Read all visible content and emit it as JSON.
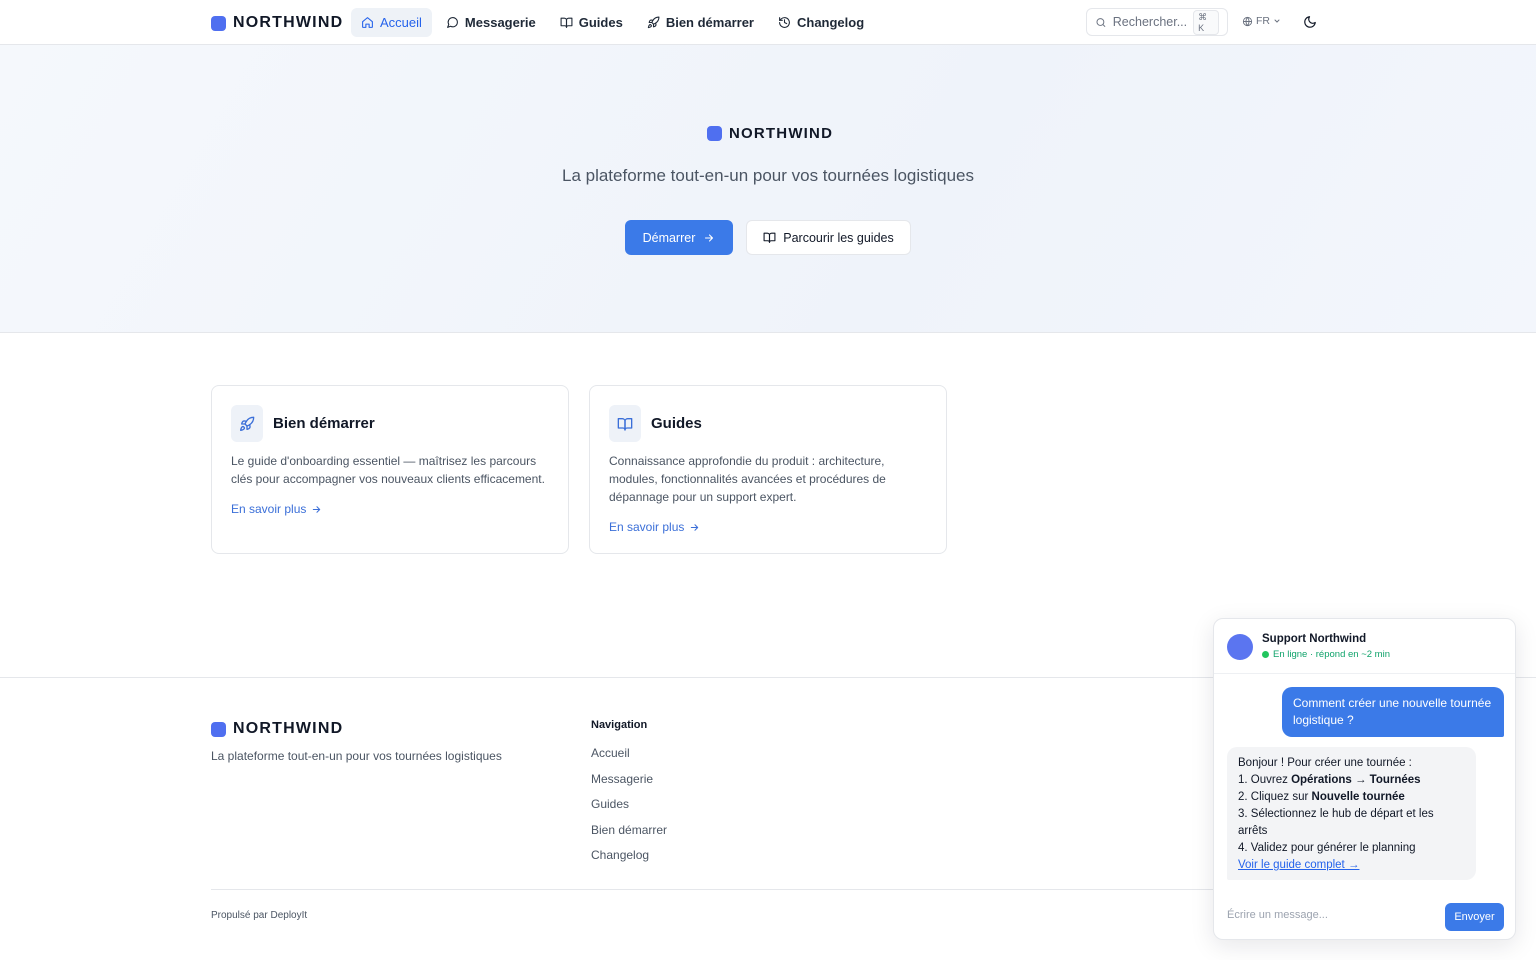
{
  "colors": {
    "accent": "#3b7ae8",
    "brand_square": "#4f6ff0",
    "online": "#22c55e"
  },
  "header": {
    "brand": "NORTHWIND",
    "nav": [
      {
        "label": "Accueil",
        "icon": "home-icon",
        "active": true
      },
      {
        "label": "Messagerie",
        "icon": "chat-bubble-icon"
      },
      {
        "label": "Guides",
        "icon": "book-icon"
      },
      {
        "label": "Bien démarrer",
        "icon": "rocket-icon"
      },
      {
        "label": "Changelog",
        "icon": "history-icon"
      }
    ],
    "search": {
      "placeholder": "Rechercher...",
      "shortcut": "⌘ K"
    },
    "language": "FR",
    "theme_icon": "moon-icon"
  },
  "hero": {
    "brand": "NORTHWIND",
    "tagline": "La plateforme tout-en-un pour vos tournées logistiques",
    "primary_button": "Démarrer",
    "secondary_button": "Parcourir les guides"
  },
  "cards": [
    {
      "title": "Bien démarrer",
      "icon": "rocket-icon",
      "description": "Le guide d'onboarding essentiel — maîtrisez les parcours clés pour accompagner vos nouveaux clients efficacement.",
      "link": "En savoir plus"
    },
    {
      "title": "Guides",
      "icon": "book-icon",
      "description": "Connaissance approfondie du produit : architecture, modules, fonctionnalités avancées et procédures de dépannage pour un support expert.",
      "link": "En savoir plus"
    }
  ],
  "footer": {
    "brand": "NORTHWIND",
    "tagline": "La plateforme tout-en-un pour vos tournées logistiques",
    "nav_heading": "Navigation",
    "nav_links": [
      "Accueil",
      "Messagerie",
      "Guides",
      "Bien démarrer",
      "Changelog"
    ],
    "powered_by": "Propulsé par DeployIt"
  },
  "chat": {
    "agent_name": "Support Northwind",
    "status": "En ligne · répond en ~2 min",
    "user_message": "Comment créer une nouvelle tournée logistique ?",
    "bot_message": {
      "greeting": "Bonjour ! Pour créer une tournée :",
      "step1_prefix": "1. Ouvrez ",
      "step1_bold": "Opérations → Tournées",
      "step2_prefix": "2. Cliquez sur ",
      "step2_bold": "Nouvelle tournée",
      "step3_line1": "3. Sélectionnez le hub de départ et les",
      "step3_line2": "arrêts",
      "step4": "4. Validez pour générer le planning",
      "link": "Voir le guide complet →"
    },
    "input_placeholder": "Écrire un message...",
    "send_label": "Envoyer"
  }
}
